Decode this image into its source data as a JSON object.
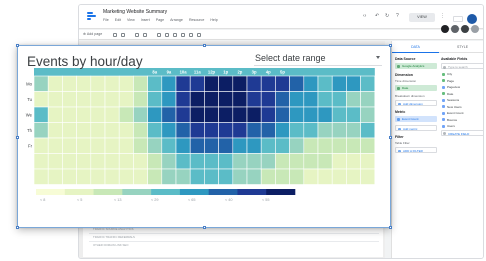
{
  "app": {
    "title": "Marketing Website Summary",
    "menu": [
      "File",
      "Edit",
      "View",
      "Insert",
      "Page",
      "Arrange",
      "Resource",
      "Help"
    ],
    "view_button": "VIEW",
    "add_page_label": "Add page"
  },
  "chart": {
    "title": "Events by hour/day",
    "date_range_placeholder": "Select date range"
  },
  "chart_data": {
    "type": "heatmap",
    "title": "Events by hour/day",
    "x": [
      "12a",
      "1a",
      "2a",
      "3a",
      "4a",
      "5a",
      "6a",
      "7a",
      "8a",
      "9a",
      "10a",
      "11a",
      "12p",
      "1p",
      "2p",
      "3p",
      "4p",
      "5p",
      "6p",
      "7p",
      "8p",
      "9p",
      "10p",
      "11p"
    ],
    "y": [
      "Mo",
      "Tu",
      "We",
      "Th",
      "Fr",
      "Sa",
      "Su"
    ],
    "visible_x_tick_labels": [
      "8a",
      "9a",
      "10a",
      "11a",
      "12p",
      "1p",
      "2p",
      "3p",
      "4p",
      "5p"
    ],
    "visible_y_tick_labels": [
      "Mo",
      "Tu",
      "We",
      "Th",
      "Fr"
    ],
    "values": [
      [
        3,
        1,
        1,
        1,
        1,
        1,
        1,
        2,
        4,
        5,
        7,
        7,
        8,
        8,
        8,
        7,
        7,
        7,
        6,
        5,
        4,
        5,
        5,
        4
      ],
      [
        1,
        1,
        1,
        1,
        1,
        1,
        1,
        2,
        4,
        5,
        7,
        8,
        8,
        8,
        8,
        7,
        7,
        6,
        5,
        5,
        4,
        4,
        3,
        3
      ],
      [
        4,
        1,
        1,
        1,
        1,
        1,
        2,
        3,
        5,
        6,
        7,
        8,
        8,
        8,
        8,
        8,
        7,
        6,
        5,
        5,
        5,
        4,
        4,
        3
      ],
      [
        3,
        1,
        1,
        1,
        1,
        1,
        1,
        2,
        4,
        5,
        6,
        7,
        7,
        7,
        7,
        6,
        6,
        5,
        4,
        4,
        3,
        3,
        3,
        4
      ],
      [
        1,
        1,
        1,
        1,
        1,
        1,
        1,
        2,
        3,
        4,
        5,
        6,
        6,
        6,
        5,
        5,
        4,
        4,
        3,
        2,
        2,
        2,
        2,
        2
      ],
      [
        1,
        1,
        1,
        1,
        1,
        1,
        1,
        1,
        2,
        3,
        4,
        4,
        4,
        4,
        3,
        3,
        3,
        2,
        2,
        2,
        2,
        1,
        1,
        1
      ],
      [
        1,
        1,
        1,
        1,
        1,
        1,
        1,
        1,
        2,
        3,
        3,
        4,
        4,
        4,
        3,
        3,
        2,
        2,
        2,
        1,
        1,
        1,
        1,
        1
      ]
    ],
    "color_scale": [
      "#f7fcd6",
      "#e6f4c3",
      "#c8e8b7",
      "#97d3c0",
      "#5bbcc7",
      "#2e98c0",
      "#2262a8",
      "#1f3a94",
      "#0c1e64"
    ],
    "legend_labels": [
      "< 8",
      "< 5",
      "< 13",
      "< 29",
      "< 65",
      "< 40",
      "< 55"
    ],
    "grid": true
  },
  "toolbar": {
    "icons": [
      "undo-icon",
      "redo-icon",
      "select-icon",
      "zoom-icon",
      "chart-icon",
      "line-icon",
      "table-icon",
      "text-icon",
      "image-icon",
      "shape-icon"
    ]
  },
  "panel": {
    "tabs": [
      "DATA",
      "STYLE"
    ],
    "data_source_label": "Data Source",
    "data_source_value": "Google Analytics",
    "dimension_label": "Dimension",
    "time_dimension_label": "Time dimension",
    "time_dimension_value": "Date",
    "breakdown_label": "Breakdown dimension",
    "add_dimension": "Add dimension",
    "metric_label": "Metric",
    "metric_value": "Event Count",
    "add_metric": "Add metric",
    "filter_label": "Filter",
    "filter_sub": "Table Filter",
    "add_filter": "ADD A FILTER",
    "available_fields_label": "Available Fields",
    "search_placeholder": "Type to search",
    "fields": [
      "City",
      "Page",
      "Pageview",
      "Date",
      "Sessions",
      "New Users",
      "Event Count",
      "Bounce",
      "Users",
      "CREATE FIELD"
    ]
  },
  "table": {
    "rows": [
      "OBSERVED AREA TEXT",
      "TRAFFIC SOURCE ANALYTICS",
      "TRAFFIC TRAFFIC REFERRALS",
      "OTHER DOMAIN LINK SEO"
    ]
  }
}
